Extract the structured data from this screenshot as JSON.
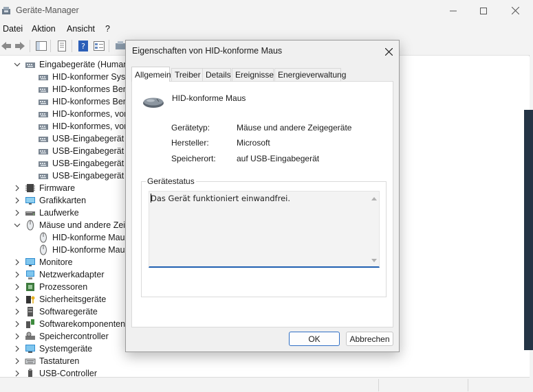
{
  "window": {
    "title": "Geräte-Manager",
    "menu": [
      "Datei",
      "Aktion",
      "Ansicht",
      "?"
    ]
  },
  "tree": {
    "items": [
      {
        "label": "Eingabegeräte (Human",
        "icon": "hid-category-icon",
        "expanded": true
      },
      {
        "label": "HID-konformer Syst",
        "icon": "hid-device-icon"
      },
      {
        "label": "HID-konformes Ben",
        "icon": "hid-device-icon"
      },
      {
        "label": "HID-konformes Ben",
        "icon": "hid-device-icon"
      },
      {
        "label": "HID-konformes, vor",
        "icon": "hid-device-icon"
      },
      {
        "label": "HID-konformes, vor",
        "icon": "hid-device-icon"
      },
      {
        "label": "USB-Eingabegerät",
        "icon": "hid-device-icon"
      },
      {
        "label": "USB-Eingabegerät",
        "icon": "hid-device-icon"
      },
      {
        "label": "USB-Eingabegerät",
        "icon": "hid-device-icon"
      },
      {
        "label": "USB-Eingabegerät",
        "icon": "hid-device-icon"
      },
      {
        "label": "Firmware",
        "icon": "firmware-icon"
      },
      {
        "label": "Grafikkarten",
        "icon": "display-adapter-icon"
      },
      {
        "label": "Laufwerke",
        "icon": "disk-drive-icon"
      },
      {
        "label": "Mäuse und andere Zeig",
        "icon": "mouse-category-icon",
        "expanded": true
      },
      {
        "label": "HID-konforme Maus",
        "icon": "mouse-device-icon"
      },
      {
        "label": "HID-konforme Maus",
        "icon": "mouse-device-icon"
      },
      {
        "label": "Monitore",
        "icon": "monitor-icon"
      },
      {
        "label": "Netzwerkadapter",
        "icon": "network-adapter-icon"
      },
      {
        "label": "Prozessoren",
        "icon": "processor-icon"
      },
      {
        "label": "Sicherheitsgeräte",
        "icon": "security-device-icon"
      },
      {
        "label": "Softwaregeräte",
        "icon": "software-device-icon"
      },
      {
        "label": "Softwarekomponenten",
        "icon": "software-component-icon"
      },
      {
        "label": "Speichercontroller",
        "icon": "storage-controller-icon"
      },
      {
        "label": "Systemgeräte",
        "icon": "system-device-icon"
      },
      {
        "label": "Tastaturen",
        "icon": "keyboard-icon"
      },
      {
        "label": "USB-Controller",
        "icon": "usb-controller-icon"
      }
    ]
  },
  "dialog": {
    "title": "Eigenschaften von HID-konforme Maus",
    "tabs": [
      "Allgemein",
      "Treiber",
      "Details",
      "Ereignisse",
      "Energieverwaltung"
    ],
    "active_tab": "Allgemein",
    "device_name": "HID-konforme Maus",
    "props": [
      {
        "label": "Gerätetyp:",
        "value": "Mäuse und andere Zeigegeräte"
      },
      {
        "label": "Hersteller:",
        "value": "Microsoft"
      },
      {
        "label": "Speicherort:",
        "value": "auf USB-Eingabegerät"
      }
    ],
    "status_group_label": "Gerätestatus",
    "status_text": "Das Gerät funktioniert einwandfrei.",
    "ok_label": "OK",
    "cancel_label": "Abbrechen"
  },
  "colors": {
    "accent": "#1f5fb0",
    "dialog_bg": "#f0f0f0",
    "taskbar_edge": "#243445"
  }
}
